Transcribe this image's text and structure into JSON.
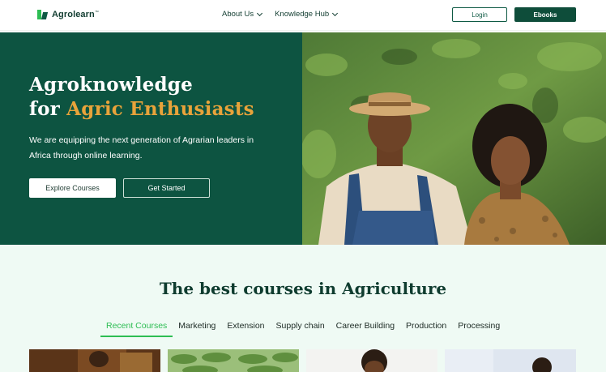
{
  "nav": {
    "logo_text": "Agrolearn",
    "logo_tm": "™",
    "menu": [
      {
        "label": "About Us"
      },
      {
        "label": "Knowledge Hub"
      }
    ],
    "login_label": "Login",
    "ebooks_label": "Ebooks"
  },
  "hero": {
    "title_line1": "Agroknowledge",
    "title_for": "for",
    "title_accent": "Agric Enthusiasts",
    "subtitle": "We are equipping the next generation of Agrarian leaders in Africa through online learning.",
    "explore_label": "Explore Courses",
    "started_label": "Get Started"
  },
  "courses": {
    "title": "The best courses in Agriculture",
    "tabs": [
      "Recent Courses",
      "Marketing",
      "Extension",
      "Supply chain",
      "Career Building",
      "Production",
      "Processing"
    ],
    "active_tab": 0
  },
  "colors": {
    "brand_dark": "#0d5441",
    "accent_gold": "#e8a33a",
    "accent_green": "#2dbd53",
    "section_bg": "#effaf4"
  },
  "icons": [
    "logo-icon",
    "chevron-down-icon"
  ]
}
